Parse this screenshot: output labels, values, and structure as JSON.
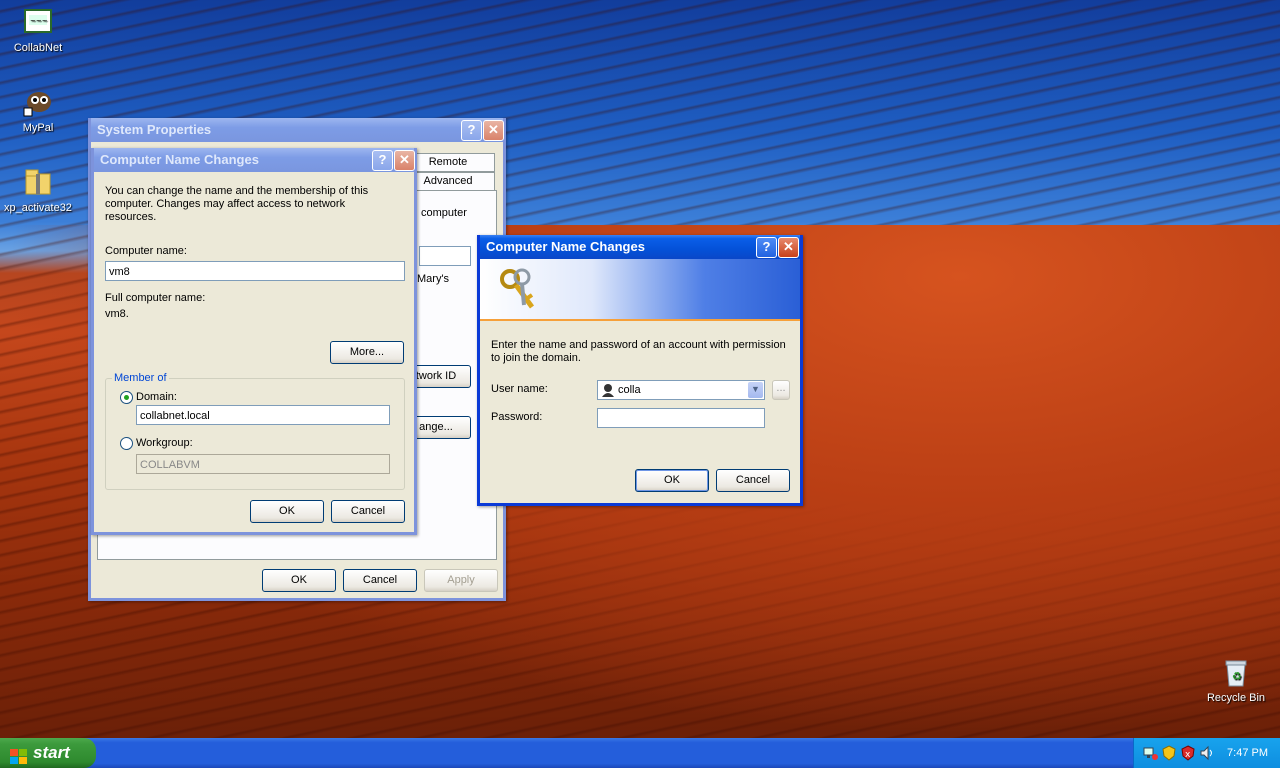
{
  "desktop": {
    "icons": [
      {
        "label": "CollabNet",
        "icon": "collabnet-icon"
      },
      {
        "label": "MyPal",
        "icon": "mypal-browser-icon"
      },
      {
        "label": "xp_activate32",
        "icon": "zip-folder-icon"
      },
      {
        "label": "Recycle Bin",
        "icon": "recycle-bin-icon"
      }
    ]
  },
  "system_properties": {
    "title": "System Properties",
    "tabs": [
      "Remote",
      "Advanced"
    ],
    "partial_texts": [
      "computer",
      "Mary's"
    ],
    "network_id_label": "twork ID",
    "change_label": "ange...",
    "ok": "OK",
    "cancel": "Cancel",
    "apply": "Apply"
  },
  "name_changes": {
    "title": "Computer Name Changes",
    "description": "You can change the name and the membership of this computer. Changes may affect access to network resources.",
    "computer_name_label": "Computer name:",
    "computer_name_value": "vm8",
    "full_name_label": "Full computer name:",
    "full_name_value": "vm8.",
    "more_button": "More...",
    "member_of_label": "Member of",
    "domain_label": "Domain:",
    "domain_value": "collabnet.local",
    "domain_selected": true,
    "workgroup_label": "Workgroup:",
    "workgroup_value": "COLLABVM",
    "ok": "OK",
    "cancel": "Cancel"
  },
  "credentials": {
    "title": "Computer Name Changes",
    "description": "Enter the name and password of an account with permission to join the domain.",
    "username_label": "User name:",
    "username_value": "colla",
    "password_label": "Password:",
    "password_value": "",
    "browse_button": "...",
    "ok": "OK",
    "cancel": "Cancel"
  },
  "taskbar": {
    "start_label": "start",
    "clock": "7:47 PM",
    "tray_icons": [
      "network-icon",
      "security-shield-icon",
      "alert-shield-icon",
      "volume-icon"
    ]
  },
  "colors": {
    "titlebar_active": "#0a5ee8",
    "window_face": "#ece9d8",
    "start_green": "#3c9a3c"
  }
}
